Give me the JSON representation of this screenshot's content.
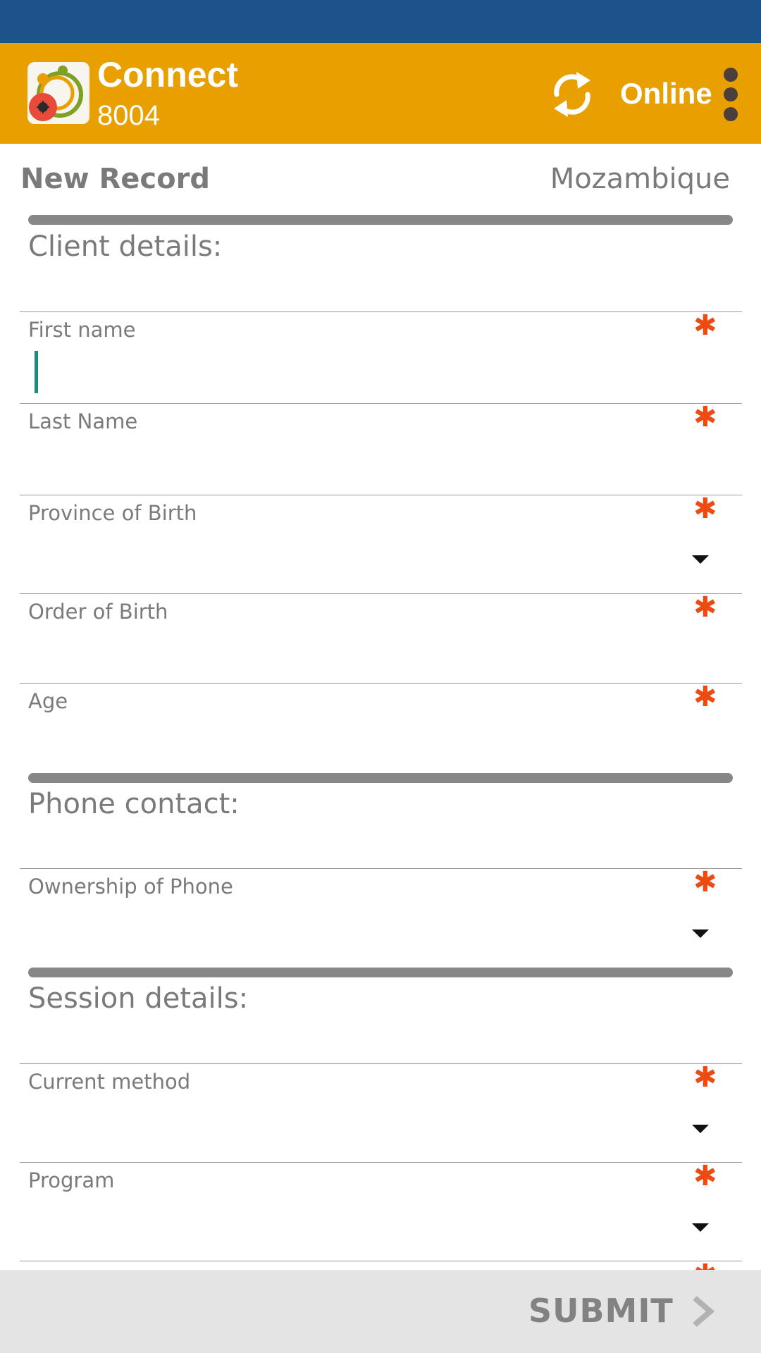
{
  "app": {
    "title": "Connect",
    "subtitle": "8004",
    "status": "Online",
    "icons": {
      "logo": "app-logo",
      "sync": "sync-icon",
      "menu": "more-vert-icon"
    },
    "colors": {
      "status_bar": "#1e528a",
      "app_bar": "#e89f00",
      "required": "#ee4b12",
      "cursor": "#1c8c80"
    }
  },
  "page": {
    "title": "New Record",
    "country": "Mozambique"
  },
  "sections": {
    "client": {
      "title": "Client details:",
      "fields": {
        "first_name": {
          "label": "First name",
          "required": "*",
          "value": ""
        },
        "last_name": {
          "label": "Last Name",
          "required": "*",
          "value": ""
        },
        "province": {
          "label": "Province of Birth",
          "required": "*",
          "value": ""
        },
        "order": {
          "label": "Order of Birth",
          "required": "*",
          "value": ""
        },
        "age": {
          "label": "Age",
          "required": "*",
          "value": ""
        }
      }
    },
    "phone": {
      "title": "Phone contact:",
      "fields": {
        "ownership": {
          "label": "Ownership of Phone",
          "required": "*",
          "value": ""
        }
      }
    },
    "session": {
      "title": "Session details:",
      "fields": {
        "method": {
          "label": "Current method",
          "required": "*",
          "value": ""
        },
        "program": {
          "label": "Program",
          "required": "*",
          "value": ""
        }
      }
    }
  },
  "footer": {
    "submit_label": "SUBMIT"
  }
}
